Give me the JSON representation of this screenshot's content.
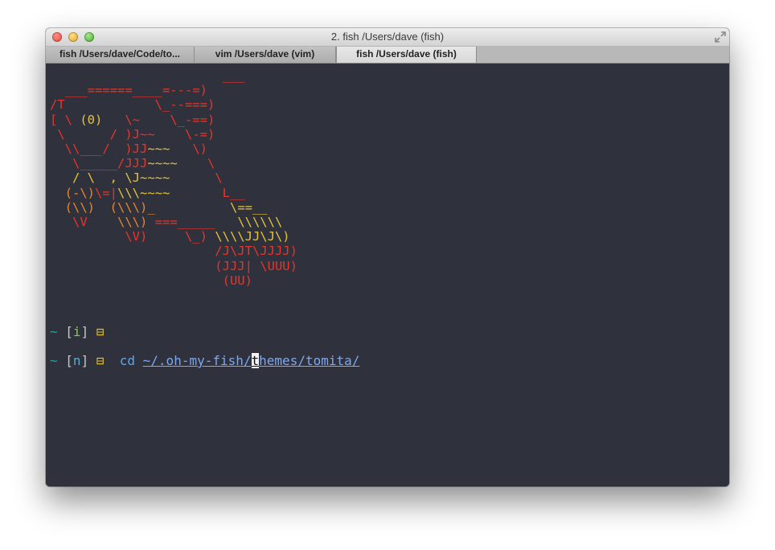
{
  "window": {
    "title": "2. fish  /Users/dave (fish)"
  },
  "tabs": [
    {
      "label": "fish  /Users/dave/Code/to...",
      "active": false
    },
    {
      "label": "vim  /Users/dave (vim)",
      "active": false
    },
    {
      "label": "fish  /Users/dave (fish)",
      "active": true
    }
  ],
  "terminal": {
    "prompt1": {
      "tilde": "~",
      "mode_open": "[",
      "mode": "i",
      "mode_close": "]",
      "symbol": "⊟"
    },
    "prompt2": {
      "tilde": "~",
      "mode_open": "[",
      "mode": "n",
      "mode_close": "]",
      "symbol": "⊟",
      "command": "cd",
      "path_before_cursor": "~/.oh-my-fish/",
      "cursor_char": "t",
      "path_after_cursor": "hemes/tomita/"
    }
  },
  "icons": {
    "close": "close-light-icon",
    "minimize": "minimize-light-icon",
    "zoom": "zoom-light-icon",
    "fullscreen": "fullscreen-arrows-icon"
  },
  "colors": {
    "terminal_bg": "#2f313c",
    "ascii_red": "#e8352a",
    "ascii_yellow": "#e5c43a",
    "prompt_tilde": "#2aa198",
    "mode_insert": "#7fd13b",
    "mode_normal": "#4fb0d8"
  }
}
